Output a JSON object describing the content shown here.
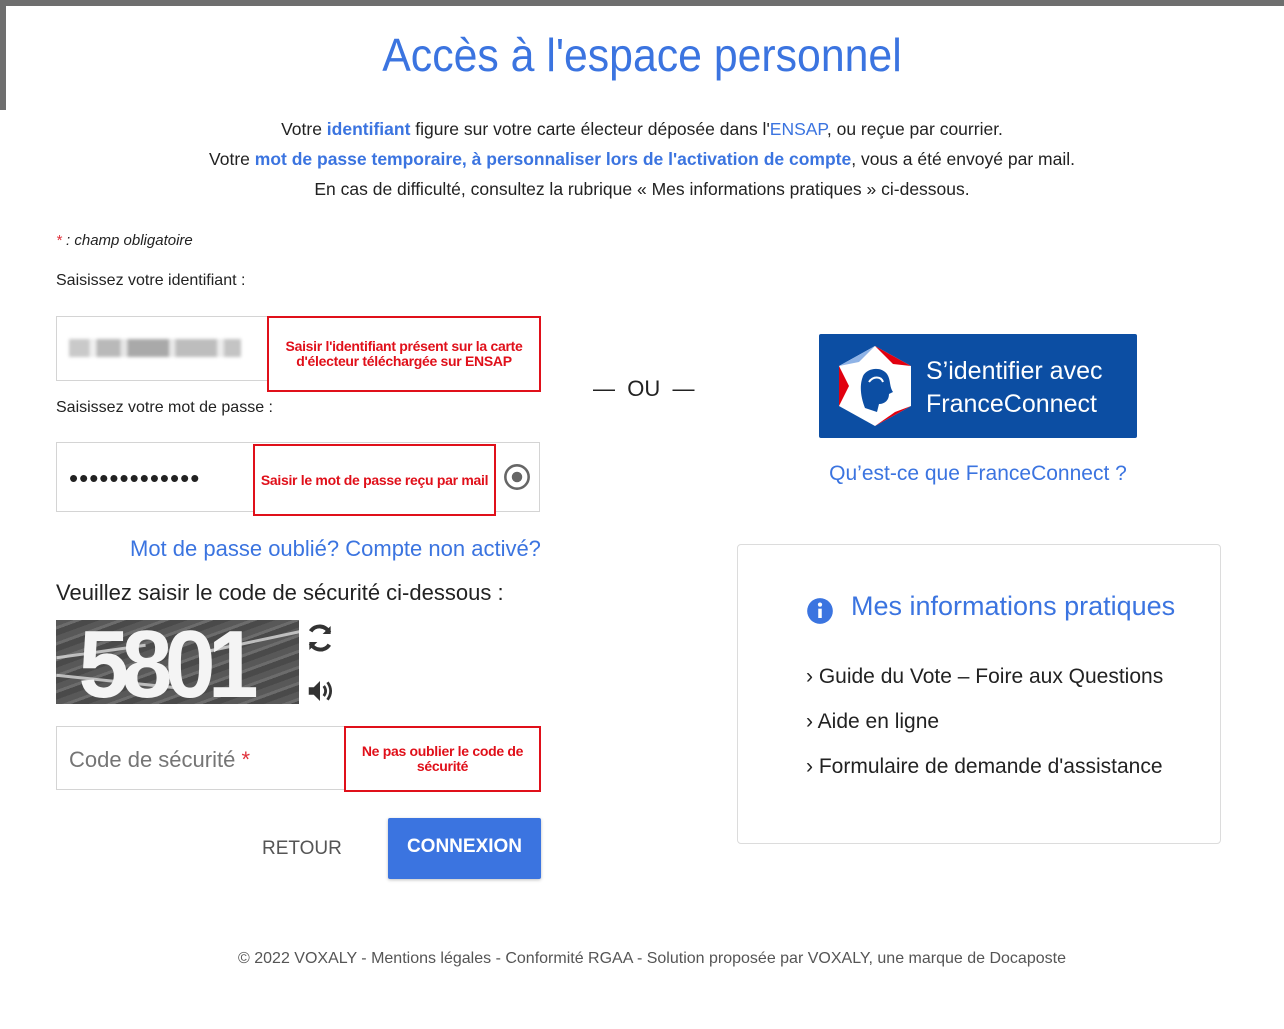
{
  "header": {
    "title": "Accès à l'espace personnel",
    "intro": {
      "l1_a": "Votre ",
      "l1_b": "identifiant",
      "l1_c": " figure sur votre carte électeur déposée dans l'",
      "l1_d": "ENSAP",
      "l1_e": ", ou reçue par courrier.",
      "l2_a": "Votre ",
      "l2_b": "mot de passe temporaire, à personnaliser lors de l'activation de compte",
      "l2_c": ", vous a été envoyé par mail.",
      "l3": "En cas de difficulté, consultez la rubrique « Mes informations pratiques » ci-dessous."
    }
  },
  "form": {
    "required_star": "*",
    "required_note": " : champ obligatoire",
    "id_label": "Saisissez votre identifiant :",
    "id_annotation": "Saisir l'identifiant présent sur la carte d'électeur téléchargée sur ENSAP",
    "pw_label": "Saisissez votre mot de passe :",
    "pw_value": "•••••••••••••",
    "pw_annotation": "Saisir le mot de passe reçu par mail",
    "forgot_link": "Mot de passe oublié? Compte non activé?",
    "captcha_label": "Veuillez saisir le code de sécurité ci-dessous :",
    "captcha_text": "5801",
    "code_placeholder": "Code de sécurité",
    "code_star": "*",
    "code_annotation": "Ne pas oublier le code de sécurité",
    "back_button": "RETOUR",
    "submit_button": "CONNEXION"
  },
  "separator": "—  OU  —",
  "franceconnect": {
    "line1": "S’identifier avec",
    "line2": "FranceConnect",
    "what_link": "Qu’est-ce que FranceConnect ?"
  },
  "info": {
    "title": "Mes informations pratiques",
    "items": [
      "› Guide du Vote – Foire aux Questions",
      "› Aide en ligne",
      "› Formulaire de demande d'assistance"
    ]
  },
  "footer": "© 2022 VOXALY - Mentions légales - Conformité RGAA - Solution proposée par VOXALY, une marque de Docaposte",
  "colors": {
    "accent": "#3b74e0",
    "franceconnect": "#0c4ea3",
    "annotation": "#e0101a",
    "required": "#e0303a"
  }
}
